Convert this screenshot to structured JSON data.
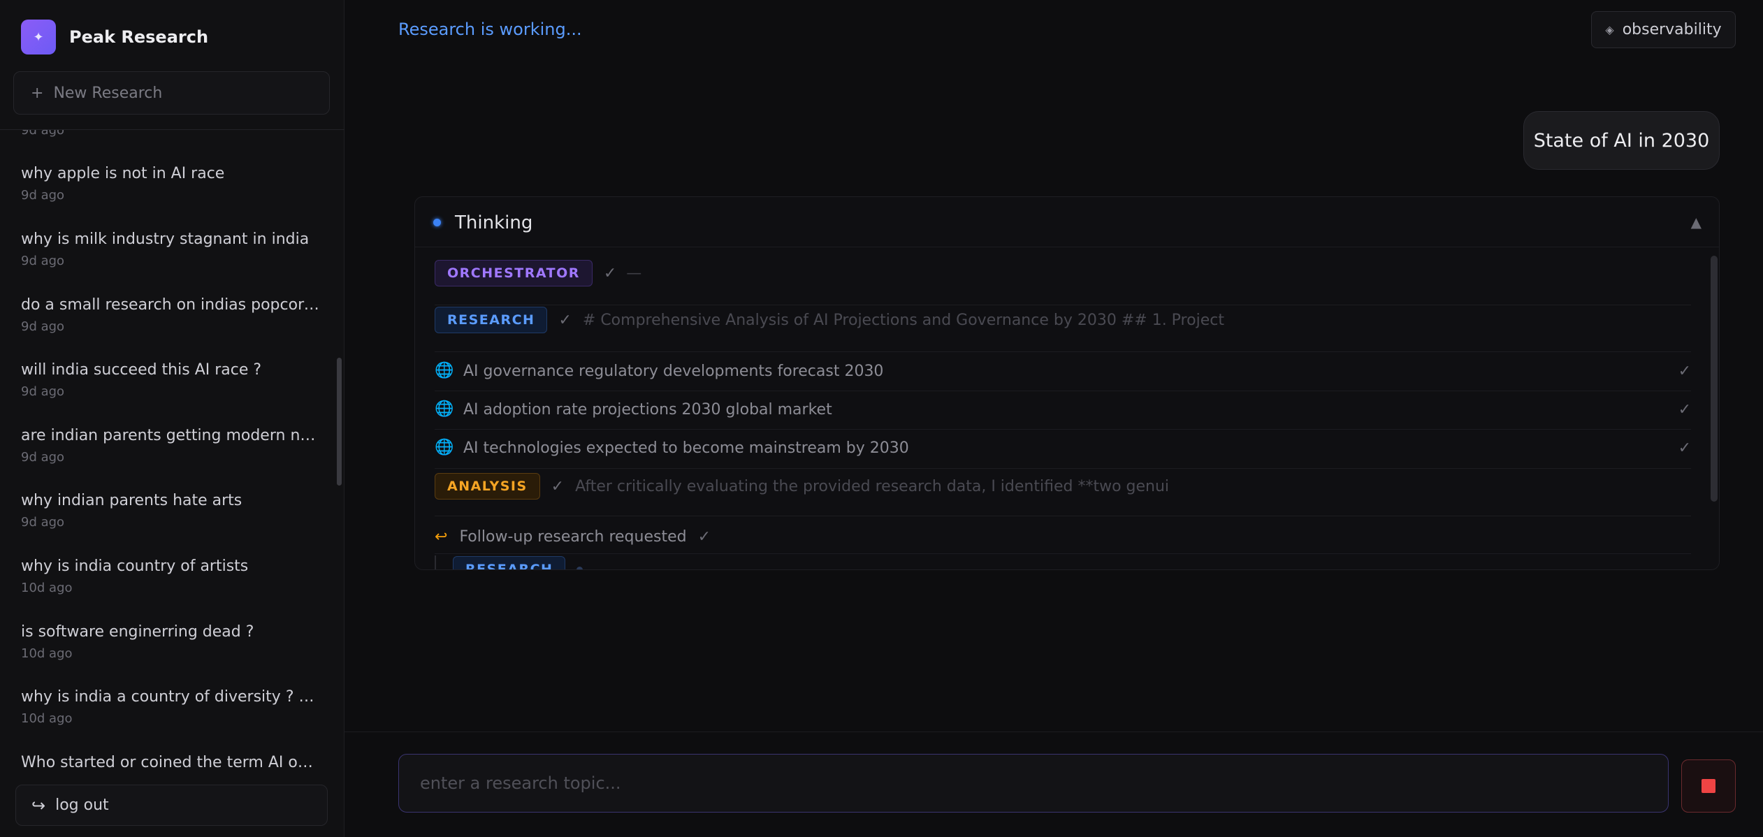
{
  "app": {
    "name": "Peak Research",
    "logo_glyph": "✦",
    "status": "Research is working...",
    "accent": "#8b5cf6"
  },
  "sidebar": {
    "new_research_icon": "+",
    "new_research_label": "New Research",
    "history_cut_time": "9d ago",
    "history": [
      {
        "title": "why apple is not in AI race",
        "time": "9d ago"
      },
      {
        "title": "why is milk industry stagnant in india",
        "time": "9d ago"
      },
      {
        "title": "do a small research on indias popcorn i...",
        "time": "9d ago"
      },
      {
        "title": "will india succeed this AI race ?",
        "time": "9d ago"
      },
      {
        "title": "are indian parents getting modern now",
        "time": "9d ago"
      },
      {
        "title": "why indian parents hate arts",
        "time": "9d ago"
      },
      {
        "title": "why is india country of artists",
        "time": "10d ago"
      },
      {
        "title": "is software enginerring dead ?",
        "time": "10d ago"
      },
      {
        "title": "why is india a country of diversity ? whe...",
        "time": "10d ago"
      },
      {
        "title": "Who started or coined the term AI on t...",
        "time": ""
      }
    ],
    "logout_label": "log out",
    "logout_icon": "logout-icon"
  },
  "header": {
    "observability_label": "observability",
    "observability_icon": "diamond-icon"
  },
  "chat": {
    "user_message": "State of AI in 2030"
  },
  "thinking": {
    "label": "Thinking",
    "collapse_glyph": "▲",
    "check": "✓",
    "dash": "—",
    "steps": {
      "orchestrator_tag": "ORCHESTRATOR",
      "research_tag": "RESEARCH",
      "research_preview": "# Comprehensive Analysis of AI Projections and Governance by 2030 ## 1. Project",
      "queries": [
        "AI governance regulatory developments forecast 2030",
        "AI adoption rate projections 2030 global market",
        "AI technologies expected to become mainstream by 2030"
      ],
      "analysis_tag": "ANALYSIS",
      "analysis_preview": "After critically evaluating the provided research data, I identified **two genui",
      "followup_label": "Follow-up research requested",
      "followup_icon_glyph": "↩",
      "nested_research_tag": "RESEARCH"
    }
  },
  "composer": {
    "placeholder": "enter a research topic...",
    "value": "",
    "stop_color": "#ef4444"
  }
}
